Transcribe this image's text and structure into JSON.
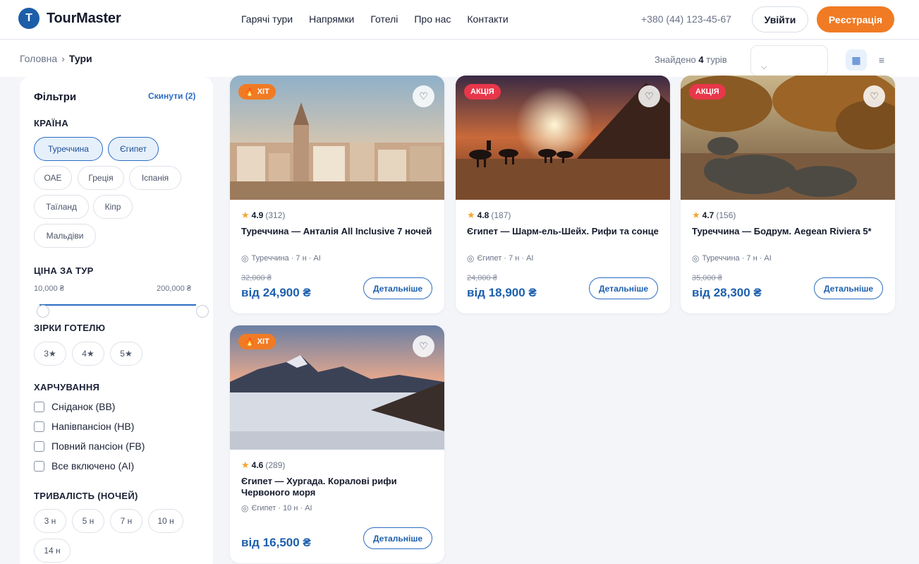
{
  "header": {
    "logo_letter": "T",
    "logo_text": "TourMaster",
    "nav": [
      "Гарячі тури",
      "Напрямки",
      "Готелі",
      "Про нас",
      "Контакти"
    ],
    "phone": "+380 (44) 123-45-67",
    "login": "Увійти",
    "register": "Реєстрація"
  },
  "subbar": {
    "breadcrumb_home": "Головна",
    "breadcrumb_sep": "›",
    "breadcrumb_current": "Тури",
    "found_prefix": "Знайдено",
    "found_count": "4",
    "found_suffix": "турів",
    "sort_chevron": "⌵",
    "grid_icon": "▦",
    "list_icon": "≡"
  },
  "filters": {
    "title": "Фільтри",
    "reset": "Скинути (2)",
    "country_label": "КРАЇНА",
    "countries": [
      "Туреччина",
      "Єгипет",
      "ОАЕ",
      "Греція",
      "Іспанія",
      "Таїланд",
      "Кіпр",
      "Мальдіви"
    ],
    "active_countries": [
      "Туреччина",
      "Єгипет"
    ],
    "price_label": "ЦІНА ЗА ТУР",
    "price_min": "10,000 ₴",
    "price_max": "200,000 ₴",
    "stars_label": "ЗІРКИ ГОТЕЛЮ",
    "stars": [
      "3★",
      "4★",
      "5★"
    ],
    "meals_label": "ХАРЧУВАННЯ",
    "meals": [
      "Сніданок (BB)",
      "Напівпансіон (HB)",
      "Повний пансіон (FB)",
      "Все включено (AI)"
    ],
    "nights_label": "ТРИВАЛІСТЬ (НОЧЕЙ)",
    "nights": [
      "3 н",
      "5 н",
      "7 н",
      "10 н",
      "14 н"
    ]
  },
  "cards": [
    {
      "badge": "ХІТ",
      "badge_type": "hit",
      "rating": "4.9",
      "reviews": "(312)",
      "title": "Туреччина — Анталія All Inclusive 7 ночей",
      "meta": "Туреччина · 7 н · AI",
      "old_price": "32,000 ₴",
      "price": "від 24,900 ₴",
      "details": "Детальніше",
      "fav_icon": "♡",
      "image": "istanbul"
    },
    {
      "badge": "АКЦІЯ",
      "badge_type": "promo",
      "rating": "4.8",
      "reviews": "(187)",
      "title": "Єгипет — Шарм-ель-Шейх. Рифи та сонце",
      "meta": "Єгипет · 7 н · AI",
      "old_price": "24,000 ₴",
      "price": "від 18,900 ₴",
      "details": "Детальніше",
      "fav_icon": "♡",
      "image": "pyramids"
    },
    {
      "badge": "АКЦІЯ",
      "badge_type": "promo",
      "rating": "4.7",
      "reviews": "(156)",
      "title": "Туреччина — Бодрум. Aegean Riviera 5*",
      "meta": "Туреччина · 7 н · AI",
      "old_price": "35,000 ₴",
      "price": "від 28,300 ₴",
      "details": "Детальніше",
      "fav_icon": "♡",
      "image": "savanna"
    },
    {
      "badge": "ХІТ",
      "badge_type": "hit",
      "rating": "4.6",
      "reviews": "(289)",
      "title": "Єгипет — Хургада. Коралові рифи Червоного моря",
      "meta": "Єгипет · 10 н · AI",
      "old_price": "",
      "price": "від 16,500 ₴",
      "details": "Детальніше",
      "fav_icon": "♡",
      "image": "mountains"
    }
  ],
  "icons": {
    "fire": "🔥",
    "star": "★",
    "pin": "◎"
  },
  "colors": {
    "brand": "#1c5ea8",
    "accent": "#f07b24",
    "promo": "#e8374a",
    "price": "#1d5fae"
  }
}
